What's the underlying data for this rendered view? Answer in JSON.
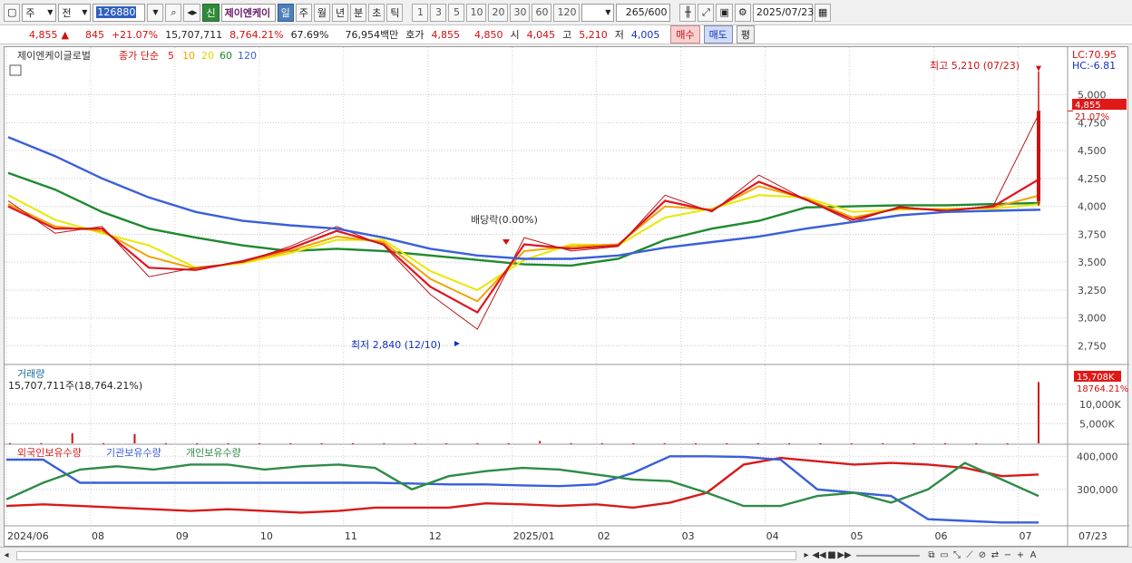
{
  "toolbar": {
    "market": "주",
    "prev": "전",
    "code": "126880",
    "stock_name": "제이엔케이",
    "new_label": "신",
    "periods": [
      "일",
      "주",
      "월",
      "년",
      "분",
      "초",
      "틱"
    ],
    "active_period": "일",
    "intervals": [
      "1",
      "3",
      "5",
      "10",
      "20",
      "30",
      "60",
      "120"
    ],
    "count": "265",
    "count_max": "/600",
    "date": "2025/07/23"
  },
  "quote": {
    "price": "4,855",
    "change": "845",
    "change_pct": "+21.07%",
    "volume": "15,707,711",
    "volume_pct": "8,764.21%",
    "turnover": "67.69%",
    "amount": "76,954백만",
    "bid_label": "호가",
    "bid1": "4,855",
    "bid2": "4,850",
    "open_label": "시",
    "open": "4,045",
    "high_label": "고",
    "high": "5,210",
    "low_label": "저",
    "low": "4,005",
    "buy_label": "매수",
    "sell_label": "매도",
    "flat_label": "평"
  },
  "legend": {
    "stock": "제이엔케이글로벌",
    "indicator": "종가 단순",
    "ma_periods": [
      "5",
      "10",
      "20",
      "60",
      "120"
    ],
    "ma_colors": [
      "#e0141e",
      "#f2a200",
      "#e8e800",
      "#1e8a2e",
      "#3a5fd8"
    ]
  },
  "price_panel": {
    "lc": "LC:70.95",
    "hc": "HC:-6.81",
    "current_label": "4,855",
    "current_pct": "21.07%",
    "high_annotation": "최고 5,210 (07/23)",
    "low_annotation": "최저 2,840 (12/10)",
    "dividend_annotation": "배당락(0.00%)"
  },
  "volume_panel": {
    "title": "거래량",
    "value": "15,707,711주(18,764.21%)",
    "current_label": "15,708K",
    "current_pct": "18764.21%"
  },
  "holding_panel": {
    "series_labels": [
      "외국인보유수량",
      "기관보유수량",
      "개인보유수량"
    ],
    "series_colors": [
      "#d81a1a",
      "#3a5fd8",
      "#2e8b46"
    ]
  },
  "x_axis_end": "07/23",
  "chart_data": [
    {
      "type": "line",
      "title": "제이엔케이글로벌",
      "x": [
        "2024/06",
        "08",
        "09",
        "10",
        "11",
        "12",
        "2025/01",
        "02",
        "03",
        "04",
        "05",
        "06",
        "07"
      ],
      "ylim": [
        2750,
        5210
      ],
      "yticks": [
        "5,000",
        "4,750",
        "4,500",
        "4,250",
        "4,000",
        "3,750",
        "3,500",
        "3,250",
        "3,000",
        "2,750"
      ],
      "series": [
        {
          "name": "종가",
          "values": [
            4050,
            3760,
            3820,
            3370,
            3450,
            3500,
            3640,
            3820,
            3650,
            3210,
            2900,
            3720,
            3600,
            3640,
            4100,
            3950,
            4280,
            4060,
            3860,
            4000,
            3950,
            4010,
            4855
          ]
        },
        {
          "name": "5",
          "values": [
            4000,
            3800,
            3800,
            3450,
            3430,
            3510,
            3620,
            3780,
            3660,
            3280,
            3050,
            3660,
            3620,
            3650,
            4050,
            3960,
            4220,
            4060,
            3880,
            3990,
            3960,
            4000,
            4250
          ]
        },
        {
          "name": "10",
          "values": [
            4020,
            3820,
            3780,
            3550,
            3440,
            3500,
            3600,
            3730,
            3680,
            3350,
            3150,
            3600,
            3640,
            3660,
            4000,
            3970,
            4180,
            4070,
            3900,
            3980,
            3970,
            3990,
            4100
          ]
        },
        {
          "name": "20",
          "values": [
            4100,
            3880,
            3760,
            3650,
            3450,
            3490,
            3580,
            3700,
            3700,
            3420,
            3250,
            3520,
            3660,
            3650,
            3900,
            3980,
            4100,
            4080,
            3950,
            3970,
            3980,
            3980,
            4020
          ]
        },
        {
          "name": "60",
          "values": [
            4300,
            4150,
            3950,
            3800,
            3720,
            3650,
            3600,
            3620,
            3600,
            3560,
            3520,
            3480,
            3470,
            3530,
            3700,
            3800,
            3870,
            3990,
            4000,
            4010,
            4010,
            4020,
            4030
          ]
        },
        {
          "name": "120",
          "values": [
            4620,
            4450,
            4250,
            4080,
            3950,
            3870,
            3830,
            3800,
            3720,
            3620,
            3560,
            3530,
            3530,
            3560,
            3630,
            3680,
            3730,
            3800,
            3860,
            3920,
            3950,
            3960,
            3970
          ]
        }
      ]
    },
    {
      "type": "bar",
      "title": "거래량",
      "yticks": [
        "10,000K",
        "5,000K"
      ],
      "values_k": [
        60,
        80,
        2600,
        60,
        2400,
        50,
        40,
        40,
        30,
        40,
        50,
        30,
        40,
        60,
        30,
        50,
        40,
        600,
        40,
        40,
        30,
        50,
        30,
        40,
        40,
        30,
        40,
        30,
        40,
        50,
        30,
        40,
        30,
        15708
      ]
    },
    {
      "type": "line",
      "title": "보유수량",
      "yticks": [
        "400,000",
        "300,000"
      ],
      "series": [
        {
          "name": "외국인보유수량",
          "values": [
            250000,
            255000,
            250000,
            245000,
            240000,
            235000,
            240000,
            235000,
            230000,
            235000,
            245000,
            245000,
            245000,
            258000,
            255000,
            250000,
            255000,
            245000,
            260000,
            290000,
            375000,
            395000,
            385000,
            375000,
            380000,
            375000,
            365000,
            340000,
            345000
          ]
        },
        {
          "name": "기관보유수량",
          "values": [
            390000,
            390000,
            320000,
            320000,
            320000,
            320000,
            320000,
            320000,
            320000,
            320000,
            320000,
            318000,
            315000,
            315000,
            312000,
            310000,
            315000,
            350000,
            400000,
            400000,
            398000,
            390000,
            300000,
            290000,
            280000,
            210000,
            205000,
            200000,
            200000
          ]
        },
        {
          "name": "개인보유수량",
          "values": [
            270000,
            320000,
            360000,
            370000,
            360000,
            375000,
            375000,
            360000,
            370000,
            375000,
            365000,
            300000,
            340000,
            355000,
            365000,
            360000,
            345000,
            330000,
            325000,
            290000,
            250000,
            250000,
            280000,
            290000,
            260000,
            300000,
            380000,
            330000,
            280000
          ]
        }
      ]
    }
  ]
}
